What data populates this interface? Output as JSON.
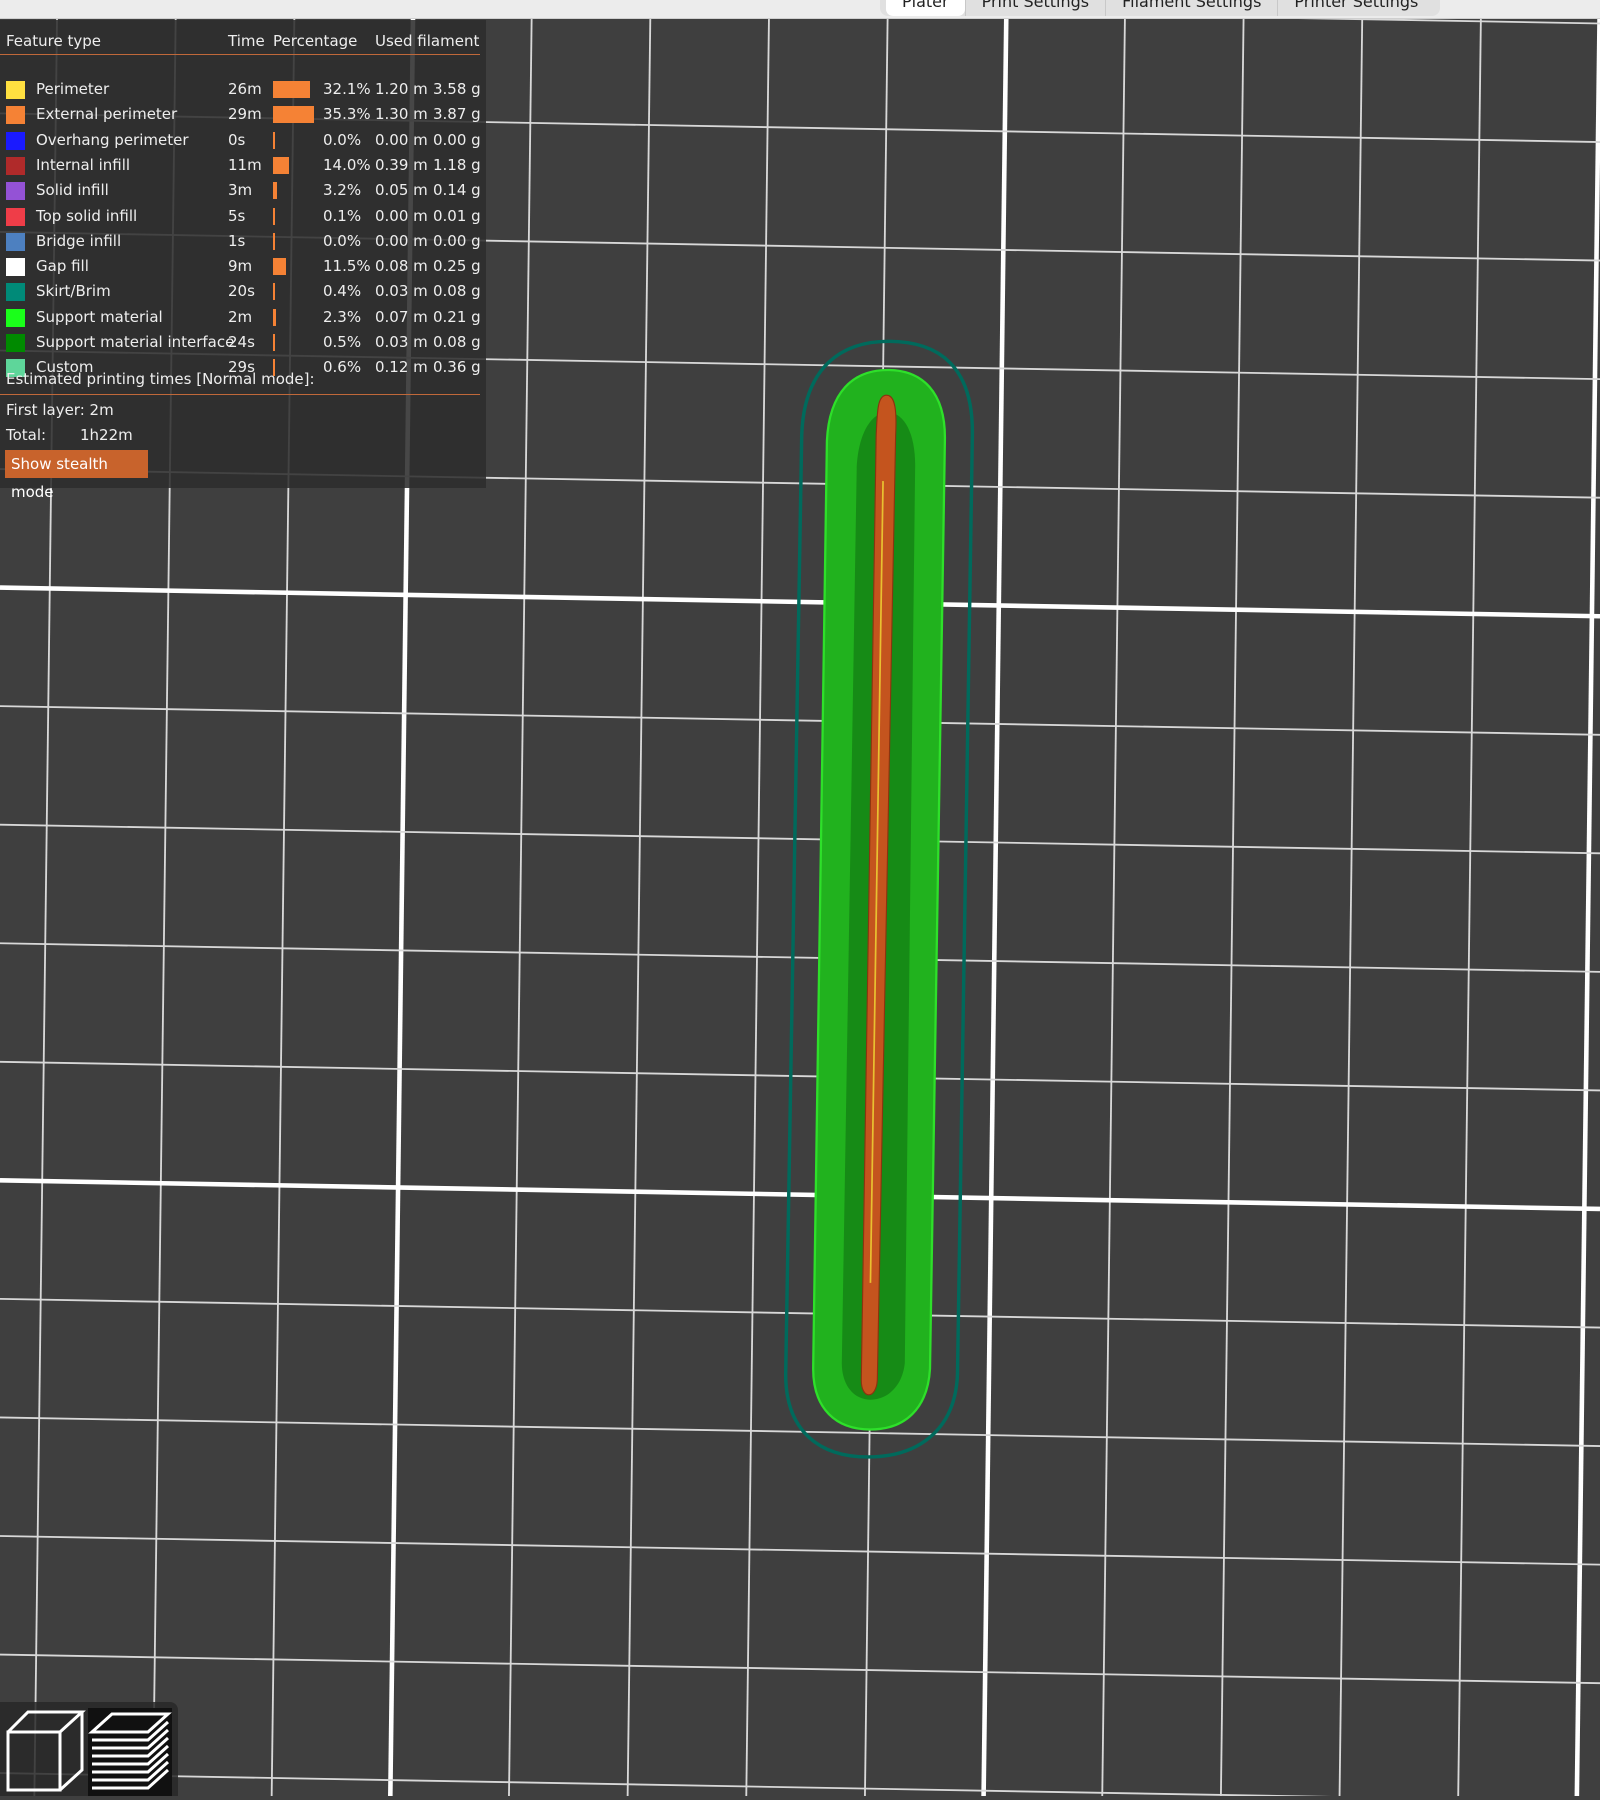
{
  "tabs": [
    "Plater",
    "Print Settings",
    "Filament Settings",
    "Printer Settings"
  ],
  "legend": {
    "headers": {
      "feature": "Feature type",
      "time": "Time",
      "percentage": "Percentage",
      "used": "Used filament"
    },
    "rows": [
      {
        "name": "Perimeter",
        "color": "#ffe040",
        "time": "26m",
        "pct": "32.1%",
        "pct_value": 32.1,
        "length": "1.20 m",
        "weight": "3.58 g"
      },
      {
        "name": "External perimeter",
        "color": "#f58235",
        "time": "29m",
        "pct": "35.3%",
        "pct_value": 35.3,
        "length": "1.30 m",
        "weight": "3.87 g"
      },
      {
        "name": "Overhang perimeter",
        "color": "#1a1aff",
        "time": "0s",
        "pct": "0.0%",
        "pct_value": 0.0,
        "length": "0.00 m",
        "weight": "0.00 g"
      },
      {
        "name": "Internal infill",
        "color": "#b02a2a",
        "time": "11m",
        "pct": "14.0%",
        "pct_value": 14.0,
        "length": "0.39 m",
        "weight": "1.18 g"
      },
      {
        "name": "Solid infill",
        "color": "#9452d6",
        "time": "3m",
        "pct": "3.2%",
        "pct_value": 3.2,
        "length": "0.05 m",
        "weight": "0.14 g"
      },
      {
        "name": "Top solid infill",
        "color": "#ef3d48",
        "time": "5s",
        "pct": "0.1%",
        "pct_value": 0.1,
        "length": "0.00 m",
        "weight": "0.01 g"
      },
      {
        "name": "Bridge infill",
        "color": "#4d80c0",
        "time": "1s",
        "pct": "0.0%",
        "pct_value": 0.0,
        "length": "0.00 m",
        "weight": "0.00 g"
      },
      {
        "name": "Gap fill",
        "color": "#ffffff",
        "time": "9m",
        "pct": "11.5%",
        "pct_value": 11.5,
        "length": "0.08 m",
        "weight": "0.25 g"
      },
      {
        "name": "Skirt/Brim",
        "color": "#008a78",
        "time": "20s",
        "pct": "0.4%",
        "pct_value": 0.4,
        "length": "0.03 m",
        "weight": "0.08 g"
      },
      {
        "name": "Support material",
        "color": "#1aff1a",
        "time": "2m",
        "pct": "2.3%",
        "pct_value": 2.3,
        "length": "0.07 m",
        "weight": "0.21 g"
      },
      {
        "name": "Support material interface",
        "color": "#008a00",
        "time": "24s",
        "pct": "0.5%",
        "pct_value": 0.5,
        "length": "0.03 m",
        "weight": "0.08 g"
      },
      {
        "name": "Custom",
        "color": "#5ed69a",
        "time": "29s",
        "pct": "0.6%",
        "pct_value": 0.6,
        "length": "0.12 m",
        "weight": "0.36 g"
      }
    ],
    "estimated_title": "Estimated printing times [Normal mode]:",
    "first_layer": "First layer: 2m",
    "total_label": "Total:",
    "total_value": "1h22m",
    "stealth_button": "Show stealth mode"
  },
  "view_buttons": [
    "3d-view-icon",
    "layers-view-icon"
  ]
}
